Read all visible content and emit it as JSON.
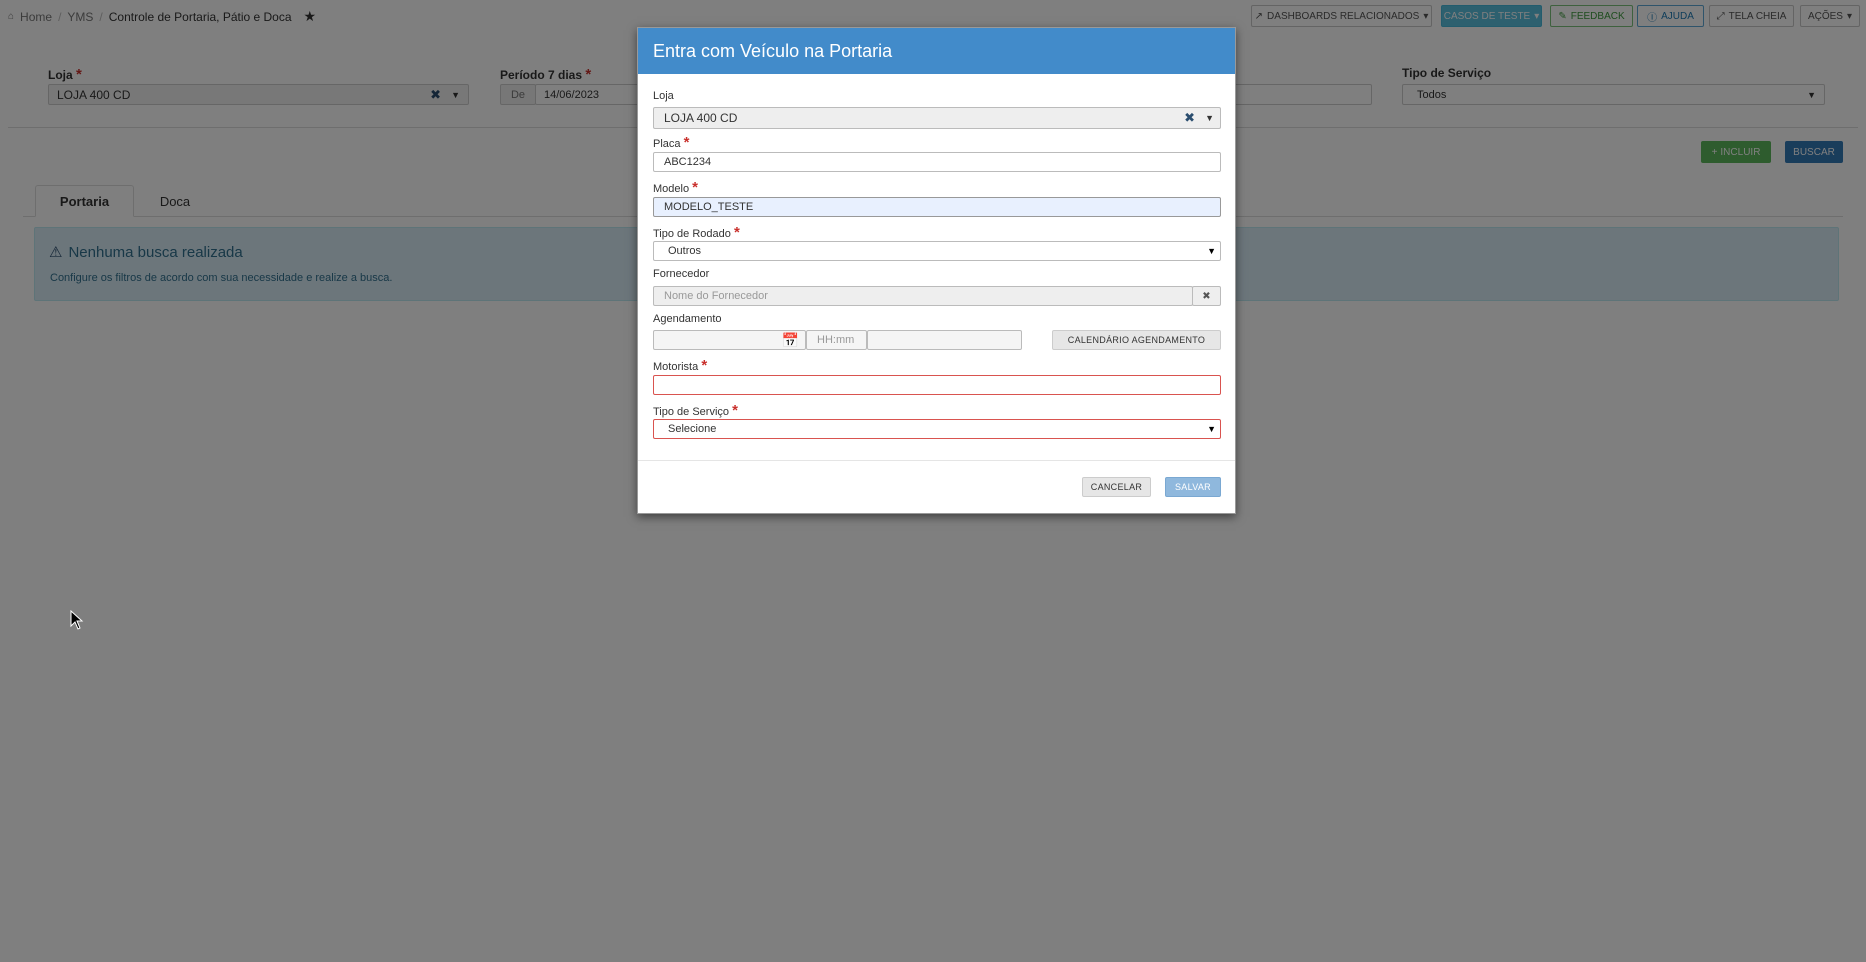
{
  "breadcrumb": {
    "home": "Home",
    "module": "YMS",
    "current": "Controle de Portaria, Pátio e Doca"
  },
  "topbar": {
    "dashboards": "DASHBOARDS RELACIONADOS",
    "cases": "CASOS DE TESTE",
    "feedback": "FEEDBACK",
    "help": "AJUDA",
    "fullscreen": "TELA CHEIA",
    "actions": "AÇÕES"
  },
  "filters": {
    "loja_label": "Loja",
    "loja_value": "LOJA 400 CD",
    "periodo_label": "Período 7 dias",
    "periodo_de": "De",
    "periodo_value": "14/06/2023",
    "tipo_servico_label": "Tipo de Serviço",
    "tipo_servico_value": "Todos"
  },
  "actions": {
    "incluir": "INCLUIR",
    "buscar": "BUSCAR"
  },
  "tabs": [
    {
      "label": "Portaria",
      "active": true
    },
    {
      "label": "Doca",
      "active": false
    }
  ],
  "alert": {
    "title": "Nenhuma busca realizada",
    "message": "Configure os filtros de acordo com sua necessidade e realize a busca."
  },
  "modal": {
    "title": "Entra com Veículo na Portaria",
    "loja_label": "Loja",
    "loja_value": "LOJA 400 CD",
    "placa_label": "Placa",
    "placa_value": "ABC1234",
    "modelo_label": "Modelo",
    "modelo_value": "MODELO_TESTE",
    "rodado_label": "Tipo de Rodado",
    "rodado_value": "Outros",
    "fornecedor_label": "Fornecedor",
    "fornecedor_placeholder": "Nome do Fornecedor",
    "agendamento_label": "Agendamento",
    "hora_placeholder": "HH:mm",
    "calendario_button": "CALENDÁRIO AGENDAMENTO",
    "motorista_label": "Motorista",
    "motorista_value": "",
    "tipo_servico_label": "Tipo de Serviço",
    "tipo_servico_value": "Selecione",
    "cancel": "CANCELAR",
    "save": "SALVAR"
  },
  "colors": {
    "header_blue": "#428bca",
    "required_red": "#c9302c",
    "incluir_green": "#5cb85c",
    "buscar_blue": "#337ab7",
    "alert_bg": "#d9edf7"
  }
}
